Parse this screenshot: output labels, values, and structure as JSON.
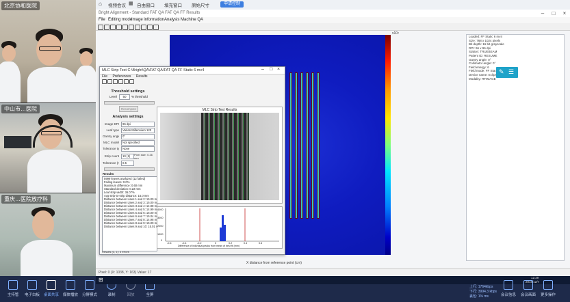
{
  "participants": [
    {
      "name": "北京协和医院"
    },
    {
      "name": "中山市…医院"
    },
    {
      "name": "重庆…医院放疗科"
    }
  ],
  "topbar": {
    "tab1": "视频会议",
    "opt1": "自由窗口",
    "opt2": "填充窗口",
    "opt3": "原始尺寸",
    "button": "申请控制"
  },
  "app": {
    "title": "Bright Alignment - Standard FAT QA FAT QA FF Results",
    "menu": [
      "File",
      "Editing mode",
      "Image information",
      "Analysis",
      "Machine QA"
    ],
    "x_axis_label": "X distance from reference point (cm)",
    "colorbar_top": "x10⁴",
    "right_panel_lines": [
      "Loaded: FF Static 6 mv4",
      "Size: 768 x 1024 pixels",
      "Bit depth: 16 bit grayscale",
      "DPI: 96 x 96 dpi",
      "Station: TRUEBEAM",
      "Patient ID: RESUME",
      "Gantry angle: 0°",
      "Collimator angle: 0°",
      "Field energy: 6",
      "Field mode: FF Stat 6",
      "Device name: Eclipse Portal Dose",
      "Modality: RTIMAGE"
    ],
    "status_text": "Pixel: 0 (X: 1038, Y: 163)  Value: 17"
  },
  "dialog": {
    "title": "MLC Strip Test  C:\\Bright\\QA\\FAT QA\\FAT QA FF Static 6 mv4",
    "menu": [
      "File",
      "Preferences",
      "Results"
    ],
    "threshold_header": "Threshold settings",
    "threshold_label": "Level",
    "threshold_value": "50",
    "threshold_unit": "% threshold",
    "apply_label": "Recompute",
    "analysis_header": "Analysis settings",
    "fields": [
      {
        "label": "Image DPI",
        "value": "96 dpi"
      },
      {
        "label": "Leaf type",
        "value": "Varian Millennium 120"
      },
      {
        "label": "Gantry angle",
        "value": "0°"
      },
      {
        "label": "MLC model",
        "value": "Not specified"
      },
      {
        "label": "Tolerance type",
        "value": "None"
      },
      {
        "label": "Strip count",
        "value": "10 (1)"
      },
      {
        "label": "Tolerance (mm)",
        "value": "0.5"
      }
    ],
    "pixel_size_note": "Pixel size: 0.26 mm",
    "results_header": "Results",
    "results": [
      "5999 leaves analyzed (12 failed)",
      "Failing leaves: 0.0%",
      "Maximum difference: 0.60 mm",
      "Standard deviation: 0.22 mm",
      "Leaf strip width: 36.07%",
      "Avg strip-to-strip distance: 15.0 mm",
      "",
      "Distance between Lines 1 and 2: 15.00 mm",
      "Distance between Lines 2 and 3: 15.00 mm",
      "Distance between Lines 3 and 4: 14.98 mm",
      "Distance between Lines 4 and 5: 14.99 mm",
      "Distance between Lines 5 and 6: 15.00 mm",
      "Distance between Lines 6 and 7: 15.04 mm",
      "Distance between Lines 7 and 8: 14.98 mm",
      "Distance between Lines 8 and 9: 15.00 mm",
      "Distance between Lines 9 and 10: 15.01 mm"
    ],
    "plot_title": "MLC Strip Test Results",
    "hist_xlabel": "Difference of individual peaks from mean of best fit (mm)",
    "hist_ticks": [
      "-0.6",
      "-0.4",
      "-0.2",
      "0",
      "0.2",
      "0.4",
      "0.6"
    ],
    "hist_yticks": [
      "4000",
      "3000",
      "2000",
      "1000",
      "0"
    ],
    "results_footer": "Results (3, 1): 3 errors"
  },
  "taskbar": {
    "buttons": [
      "主持管",
      "电子白板",
      "桌面共享",
      "媒体播放",
      "分屏模式",
      "录制",
      "回放",
      "全屏"
    ],
    "right_buttons": [
      "会议信息",
      "会议画面",
      "更多操作"
    ],
    "stats": [
      "上行: 1764kbps",
      "下行: 3994.3 kbps",
      "丢包: 1% ms"
    ],
    "clock_time": "12:39",
    "clock_date": "2018/12/7"
  }
}
